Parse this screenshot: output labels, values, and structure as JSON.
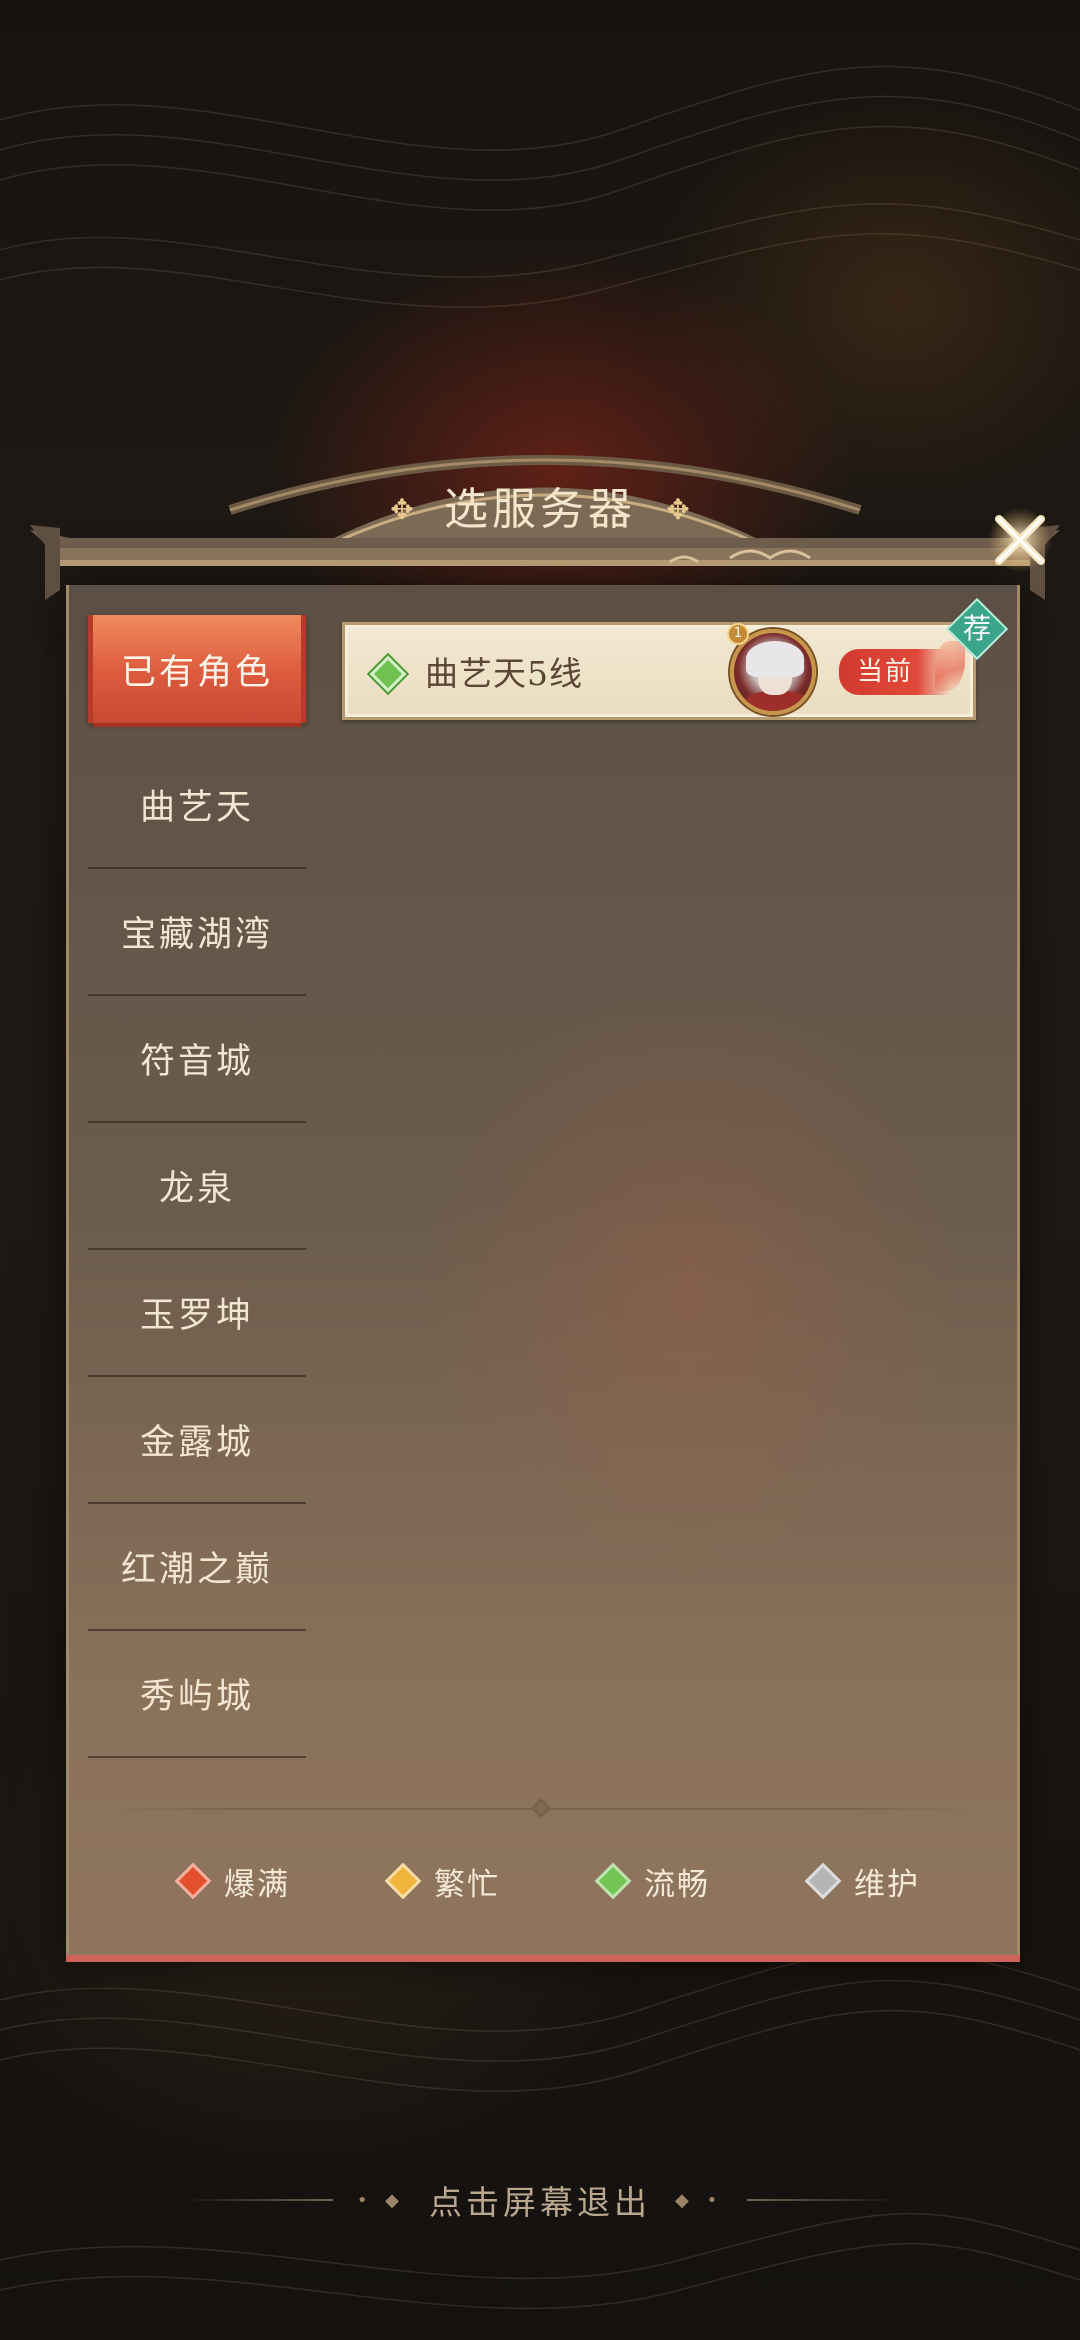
{
  "title": "选服务器",
  "tabs": [
    {
      "label": "已有角色",
      "active": true
    },
    {
      "label": "曲艺天",
      "active": false
    },
    {
      "label": "宝藏湖湾",
      "active": false
    },
    {
      "label": "符音城",
      "active": false
    },
    {
      "label": "龙泉",
      "active": false
    },
    {
      "label": "玉罗坤",
      "active": false
    },
    {
      "label": "金露城",
      "active": false
    },
    {
      "label": "红潮之巅",
      "active": false
    },
    {
      "label": "秀屿城",
      "active": false
    }
  ],
  "servers": [
    {
      "name": "曲艺天5线",
      "status": "流畅",
      "status_color": "#6fc152",
      "avatar_level": "1",
      "current_label": "当前",
      "recommend_label": "荐"
    }
  ],
  "legend": [
    {
      "label": "爆满",
      "color": "#e4502e"
    },
    {
      "label": "繁忙",
      "color": "#f0b43a"
    },
    {
      "label": "流畅",
      "color": "#72c455"
    },
    {
      "label": "维护",
      "color": "#b5b5b5"
    }
  ],
  "exit_hint": "点击屏幕退出",
  "icons": {
    "close": "close-icon",
    "title_ornament": "diamond-ornament-icon"
  }
}
